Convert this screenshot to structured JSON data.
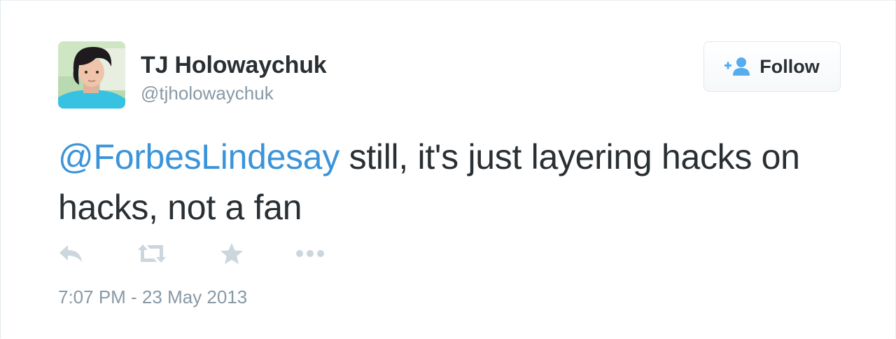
{
  "user": {
    "display_name": "TJ Holowaychuk",
    "handle": "@tjholowaychuk"
  },
  "follow_button": {
    "label": "Follow",
    "icon": "add-user-icon"
  },
  "tweet": {
    "mention": "@ForbesLindesay",
    "text": " still, it's just layering hacks on hacks, not a fan"
  },
  "actions": [
    {
      "icon": "reply-icon"
    },
    {
      "icon": "retweet-icon"
    },
    {
      "icon": "favorite-star-icon"
    },
    {
      "icon": "more-dots-icon"
    }
  ],
  "timestamp": "7:07 PM - 23 May 2013",
  "colors": {
    "text": "#292f33",
    "muted": "#8899a6",
    "link": "#3b94d9",
    "icon": "#ccd6dd",
    "follow_icon": "#55acee"
  }
}
